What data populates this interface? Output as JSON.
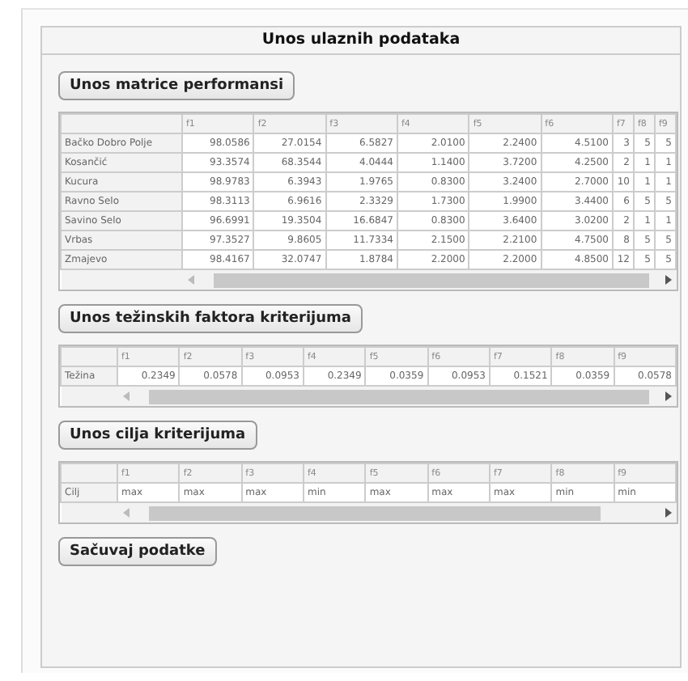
{
  "panel": {
    "title": "Unos ulaznih podataka"
  },
  "sections": [
    {
      "button": "Unos matrice performansi",
      "columns": [
        "f1",
        "f2",
        "f3",
        "f4",
        "f5",
        "f6",
        "f7",
        "f8",
        "f9"
      ],
      "rows": [
        {
          "label": "Bačko Dobro Polje",
          "cells": [
            "98.0586",
            "27.0154",
            "6.5827",
            "2.0100",
            "2.2400",
            "4.5100",
            "3",
            "5",
            "5"
          ]
        },
        {
          "label": "Kosančić",
          "cells": [
            "93.3574",
            "68.3544",
            "4.0444",
            "1.1400",
            "3.7200",
            "4.2500",
            "2",
            "1",
            "1"
          ]
        },
        {
          "label": "Kucura",
          "cells": [
            "98.9783",
            "6.3943",
            "1.9765",
            "0.8300",
            "3.2400",
            "2.7000",
            "10",
            "1",
            "1"
          ]
        },
        {
          "label": "Ravno Selo",
          "cells": [
            "98.3113",
            "6.9616",
            "2.3329",
            "1.7300",
            "1.9900",
            "3.4400",
            "6",
            "5",
            "5"
          ]
        },
        {
          "label": "Savino Selo",
          "cells": [
            "96.6991",
            "19.3504",
            "16.6847",
            "0.8300",
            "3.6400",
            "3.0200",
            "2",
            "1",
            "1"
          ]
        },
        {
          "label": "Vrbas",
          "cells": [
            "97.3527",
            "9.8605",
            "11.7334",
            "2.1500",
            "2.2100",
            "4.7500",
            "8",
            "5",
            "5"
          ]
        },
        {
          "label": "Zmajevo",
          "cells": [
            "98.4167",
            "32.0747",
            "1.8784",
            "2.2000",
            "2.2000",
            "4.8500",
            "12",
            "5",
            "5"
          ]
        }
      ]
    },
    {
      "button": "Unos težinskih faktora kriterijuma",
      "columns": [
        "f1",
        "f2",
        "f3",
        "f4",
        "f5",
        "f6",
        "f7",
        "f8",
        "f9"
      ],
      "rows": [
        {
          "label": "Težina",
          "cells": [
            "0.2349",
            "0.0578",
            "0.0953",
            "0.2349",
            "0.0359",
            "0.0953",
            "0.1521",
            "0.0359",
            "0.0578"
          ]
        }
      ]
    },
    {
      "button": "Unos cilja kriterijuma",
      "columns": [
        "f1",
        "f2",
        "f3",
        "f4",
        "f5",
        "f6",
        "f7",
        "f8",
        "f9"
      ],
      "rows": [
        {
          "label": "Cilj",
          "cells": [
            "max",
            "max",
            "max",
            "min",
            "max",
            "max",
            "max",
            "min",
            "min"
          ],
          "kind": "text"
        }
      ]
    }
  ],
  "save_button": "Sačuvaj podatke"
}
